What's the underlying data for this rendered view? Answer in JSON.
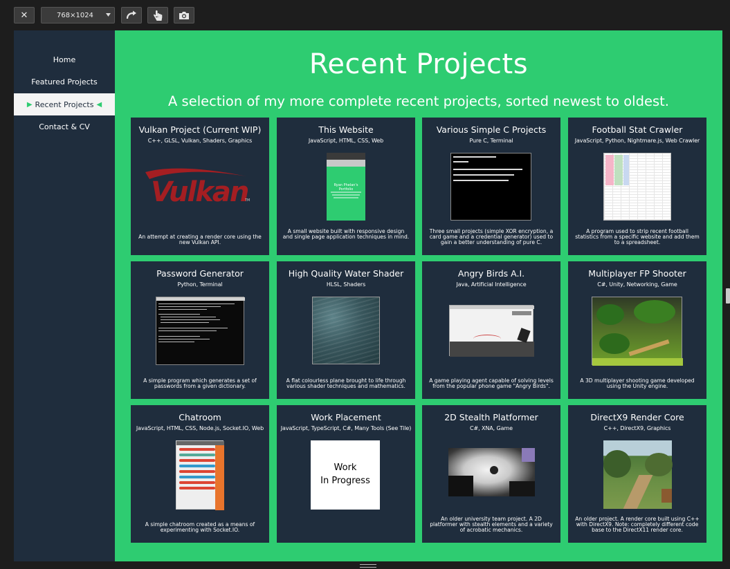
{
  "toolbar": {
    "close_glyph": "✕",
    "viewport_size": "768×1024",
    "rotate_icon": "rotate-icon",
    "touch_icon": "touch-hand-icon",
    "screenshot_icon": "camera-icon"
  },
  "sidebar": {
    "items": [
      {
        "label": "Home",
        "active": false
      },
      {
        "label": "Featured Projects",
        "active": false
      },
      {
        "label": "Recent Projects",
        "active": true
      },
      {
        "label": "Contact & CV",
        "active": false
      }
    ],
    "active_arrow_left": "▶",
    "active_arrow_right": "◀"
  },
  "main": {
    "title": "Recent Projects",
    "subtitle": "A selection of my more complete recent projects, sorted newest to oldest."
  },
  "cards": [
    {
      "title": "Vulkan Project (Current WIP)",
      "tags": "C++, GLSL, Vulkan, Shaders, Graphics",
      "image": "vulkan-logo",
      "logo_text": "Vulkan",
      "description": "An attempt at creating a render core using the new Vulkan API."
    },
    {
      "title": "This Website",
      "tags": "JavaScript, HTML, CSS, Web",
      "image": "website-phone-screenshot",
      "image_text": "Ryan Phelan's Portfolio",
      "description": "A small website built with responsive design and single page application techniques in mind."
    },
    {
      "title": "Various Simple C Projects",
      "tags": "Pure C, Terminal",
      "image": "terminal-card-game-screenshot",
      "description": "Three small projects (simple XOR encryption, a card game and a credential generator) used to gain a better understanding of pure C."
    },
    {
      "title": "Football Stat Crawler",
      "tags": "JavaScript, Python, Nightmare.js, Web Crawler",
      "image": "spreadsheet-screenshot",
      "description": "A program used to strip recent football statistics from a specific website and add them to a spreadsheet."
    },
    {
      "title": "Password Generator",
      "tags": "Python, Terminal",
      "image": "password-terminal-screenshot",
      "description": "A simple program which generates a set of passwords from a given dictionary."
    },
    {
      "title": "High Quality Water Shader",
      "tags": "HLSL, Shaders",
      "image": "water-shader-screenshot",
      "description": "A flat colourless plane brought to life through various shader techniques and mathematics."
    },
    {
      "title": "Angry Birds A.I.",
      "tags": "Java, Artificial Intelligence",
      "image": "angry-birds-screenshot",
      "description": "A game playing agent capable of solving levels from the popular phone game \"Angry Birds\"."
    },
    {
      "title": "Multiplayer FP Shooter",
      "tags": "C#, Unity, Networking, Game",
      "image": "fps-level-screenshot",
      "description": "A 3D multiplayer shooting game developed using the Unity engine."
    },
    {
      "title": "Chatroom",
      "tags": "JavaScript, HTML, CSS, Node.js, Socket.IO, Web",
      "image": "chatroom-phone-screenshot",
      "description": "A simple chatroom created as a means of experimenting with Socket.IO."
    },
    {
      "title": "Work Placement",
      "tags": "JavaScript, TypeScript, C#, Many Tools (See Tile)",
      "image": "work-in-progress-placeholder",
      "image_text_1": "Work",
      "image_text_2": "In Progress",
      "description": ""
    },
    {
      "title": "2D Stealth Platformer",
      "tags": "C#, XNA, Game",
      "image": "stealth-platformer-screenshot",
      "description": "An older university team project. A 2D platformer with stealth elements and a variety of acrobatic mechanics."
    },
    {
      "title": "DirectX9 Render Core",
      "tags": "C++, DirectX9, Graphics",
      "image": "terrain-render-screenshot",
      "description": "An older project. A render core built using C++ with DirectX9. Note: completely different code base to the DirectX11 render core."
    }
  ],
  "colors": {
    "background": "#1d1d1d",
    "accent_green": "#2ecc71",
    "panel_navy": "#1f2d3d",
    "vulkan_red": "#a41e22"
  }
}
